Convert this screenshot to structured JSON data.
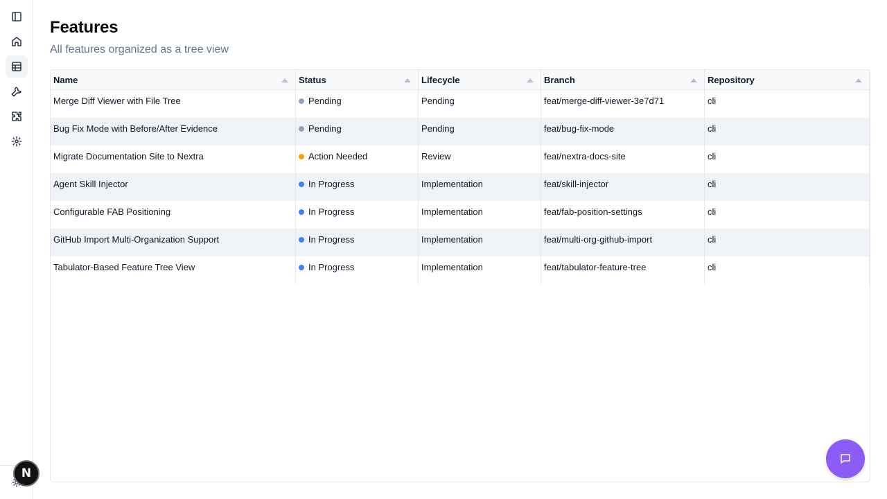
{
  "page": {
    "title": "Features",
    "subtitle": "All features organized as a tree view"
  },
  "sidebar": {
    "items": [
      {
        "icon": "panel-toggle-icon"
      },
      {
        "icon": "home-icon"
      },
      {
        "icon": "table-icon",
        "active": true
      },
      {
        "icon": "wrench-icon"
      },
      {
        "icon": "puzzle-icon"
      },
      {
        "icon": "gear-icon"
      }
    ]
  },
  "avatar": {
    "initial": "N"
  },
  "table": {
    "columns": [
      "Name",
      "Status",
      "Lifecycle",
      "Branch",
      "Repository"
    ],
    "rows": [
      {
        "name": "Merge Diff Viewer with File Tree",
        "status": "Pending",
        "status_color": "#94a3b8",
        "lifecycle": "Pending",
        "branch": "feat/merge-diff-viewer-3e7d71",
        "repository": "cli"
      },
      {
        "name": "Bug Fix Mode with Before/After Evidence",
        "status": "Pending",
        "status_color": "#94a3b8",
        "lifecycle": "Pending",
        "branch": "feat/bug-fix-mode",
        "repository": "cli"
      },
      {
        "name": "Migrate Documentation Site to Nextra",
        "status": "Action Needed",
        "status_color": "#f59e0b",
        "lifecycle": "Review",
        "branch": "feat/nextra-docs-site",
        "repository": "cli"
      },
      {
        "name": "Agent Skill Injector",
        "status": "In Progress",
        "status_color": "#3b82f6",
        "lifecycle": "Implementation",
        "branch": "feat/skill-injector",
        "repository": "cli"
      },
      {
        "name": "Configurable FAB Positioning",
        "status": "In Progress",
        "status_color": "#3b82f6",
        "lifecycle": "Implementation",
        "branch": "feat/fab-position-settings",
        "repository": "cli"
      },
      {
        "name": "GitHub Import Multi-Organization Support",
        "status": "In Progress",
        "status_color": "#3b82f6",
        "lifecycle": "Implementation",
        "branch": "feat/multi-org-github-import",
        "repository": "cli"
      },
      {
        "name": "Tabulator-Based Feature Tree View",
        "status": "In Progress",
        "status_color": "#3b82f6",
        "lifecycle": "Implementation",
        "branch": "feat/tabulator-feature-tree",
        "repository": "cli"
      }
    ]
  },
  "colors": {
    "accent": "#8b5cf6"
  }
}
